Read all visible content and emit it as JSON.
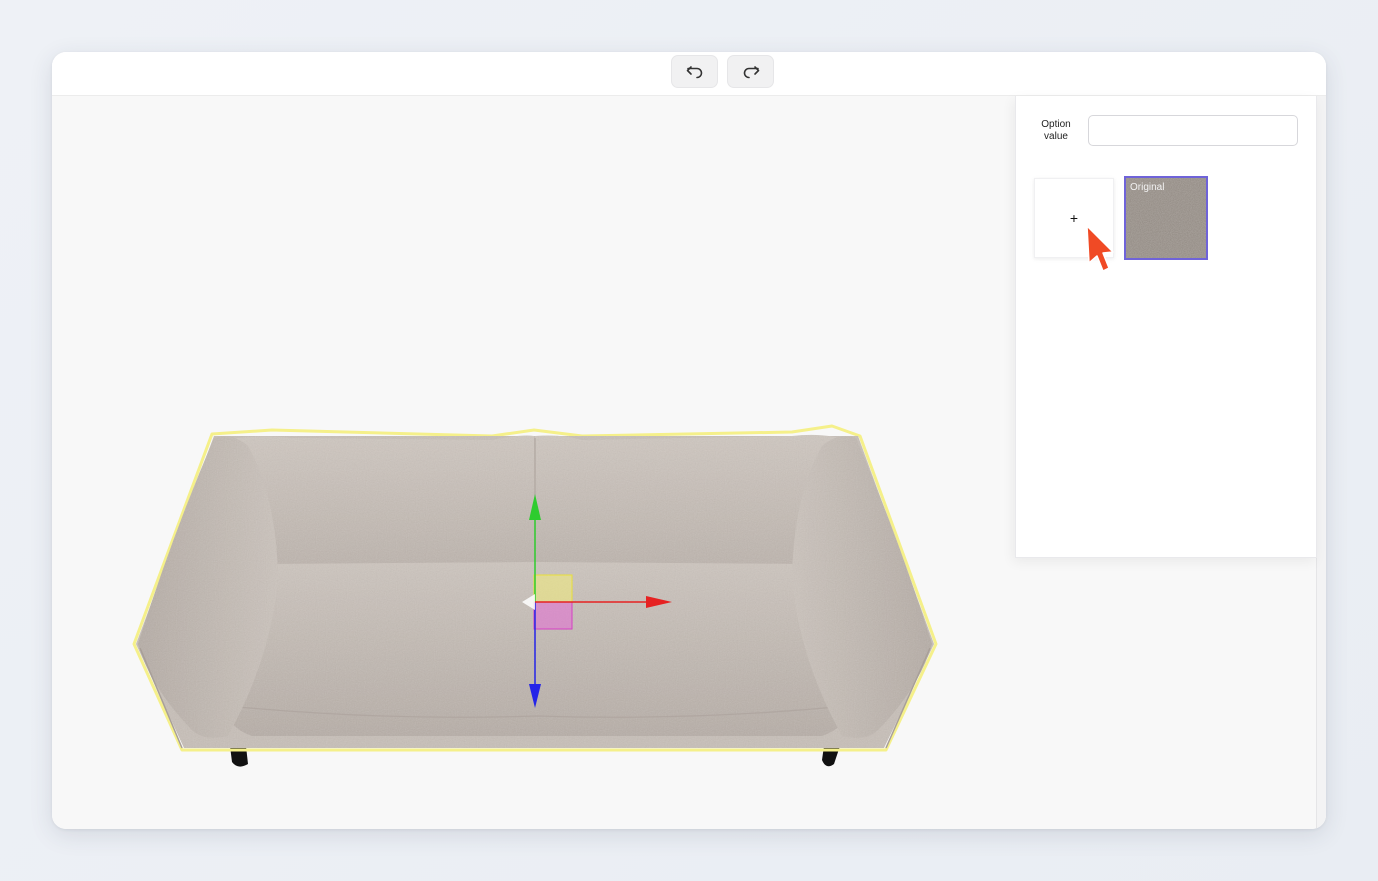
{
  "toolbar": {
    "undo_icon": "undo-icon",
    "redo_icon": "redo-icon"
  },
  "panel": {
    "option_label": "Option value",
    "option_value": "",
    "add_button_label": "+",
    "swatches": [
      {
        "label": "Original",
        "color": "#8f8780"
      }
    ],
    "selected_border_color": "#6f63d9"
  },
  "viewport": {
    "object": "sofa",
    "gizmo_colors": {
      "x": "#e62222",
      "y": "#2ecc2e",
      "z": "#2424e8"
    },
    "selection_outline_color": "#f5f08a"
  },
  "cursor_color": "#f04a25"
}
